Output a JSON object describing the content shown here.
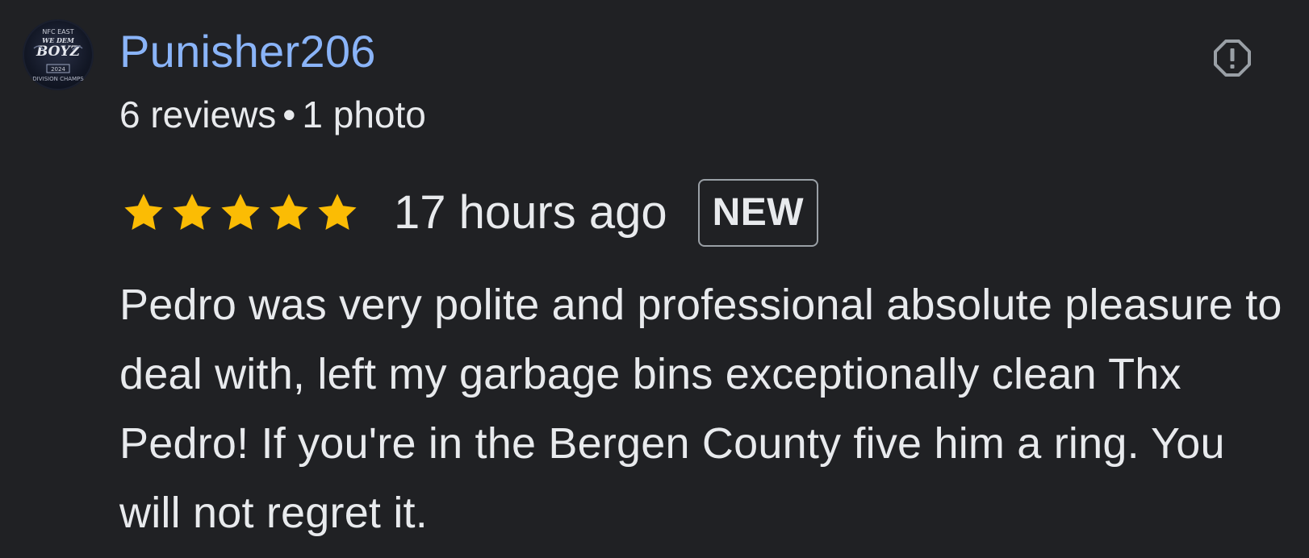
{
  "author": {
    "name": "Punisher206",
    "reviews_count": "6 reviews",
    "separator": "•",
    "photos_count": "1 photo",
    "avatar_text": {
      "line1": "NFC EAST",
      "line2": "WE DEM",
      "line3": "BOYZ",
      "line4": "2024",
      "line5": "DIVISION CHAMPS"
    }
  },
  "review": {
    "rating": 5,
    "rating_max": 5,
    "time_ago": "17 hours ago",
    "badge": "NEW",
    "text": "Pedro was very polite and professional absolute pleasure to deal with, left my garbage bins exceptionally clean Thx Pedro! If you're in the Bergen County five him a ring. You will not regret it."
  },
  "icons": {
    "report": "report-icon",
    "star": "star-icon"
  },
  "colors": {
    "background": "#202124",
    "author_name": "#8ab4f8",
    "star": "#fbbc04",
    "text": "#e8eaed",
    "badge_border": "#9aa0a6"
  }
}
